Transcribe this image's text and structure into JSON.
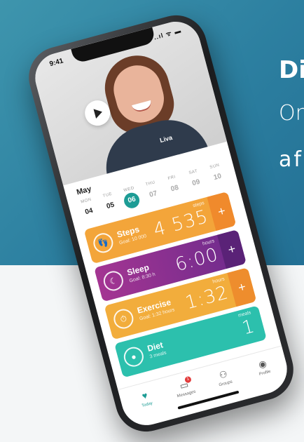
{
  "headline": {
    "line1": "Di",
    "line2": "Or",
    "line3": "af"
  },
  "status_bar": {
    "time": "9:41",
    "icons": "..ıl ᯤ ▬"
  },
  "hero": {
    "shirt_logo": "Liva"
  },
  "calendar": {
    "month": "May",
    "days": [
      {
        "name": "MON",
        "date": "04"
      },
      {
        "name": "TUE",
        "date": "05"
      },
      {
        "name": "WED",
        "date": "06"
      },
      {
        "name": "THU",
        "date": "07"
      },
      {
        "name": "FRI",
        "date": "08"
      },
      {
        "name": "SAT",
        "date": "09"
      },
      {
        "name": "SUN",
        "date": "10"
      }
    ]
  },
  "cards": {
    "steps": {
      "title": "Steps",
      "goal": "Goal: 10 000",
      "unit": "steps",
      "value": "4 535",
      "plus": "+"
    },
    "sleep": {
      "title": "Sleep",
      "goal": "Goal: 8:30 h",
      "unit": "hours",
      "value": "6:00",
      "plus": "+"
    },
    "exercise": {
      "title": "Exercise",
      "goal": "Goal: 1:32 hours",
      "unit": "hours",
      "value": "1:32",
      "plus": "+"
    },
    "diet": {
      "title": "Diet",
      "goal": "3 meals",
      "unit": "meals",
      "value": "1"
    }
  },
  "tabbar": {
    "today": "Today",
    "messages": "Messages",
    "messages_badge": "1",
    "groups": "Groups",
    "profile": "Profile"
  },
  "colors": {
    "accent": "#1d9c95",
    "steps": "#f3a53a",
    "sleep": "#8d3192",
    "exercise": "#f2ad3c",
    "diet": "#2cc0ad",
    "background": "#2c7fa0"
  }
}
